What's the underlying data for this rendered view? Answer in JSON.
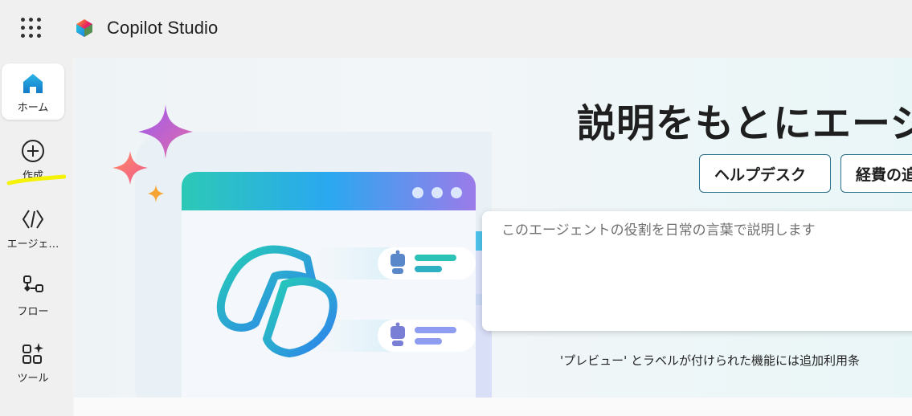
{
  "app": {
    "title": "Copilot Studio"
  },
  "rail": {
    "items": [
      {
        "label": "ホーム",
        "icon": "home-icon",
        "active": true
      },
      {
        "label": "作成",
        "icon": "plus-circle-icon"
      },
      {
        "label": "エージェ…",
        "icon": "code-brackets-icon"
      },
      {
        "label": "フロー",
        "icon": "flow-icon"
      },
      {
        "label": "ツール",
        "icon": "tools-icon"
      }
    ]
  },
  "hero": {
    "title": "説明をもとにエージ",
    "chips": [
      "ヘルプデスク",
      "経費の追"
    ],
    "prompt_placeholder": "このエージェントの役割を日常の言葉で説明します",
    "disclaimer": "'プレビュー' とラベルが付けられた機能には追加利用条"
  },
  "colors": {
    "accent": "#0f6cbd",
    "highlight": "#f5f20a",
    "home_icon": "#1a9bd7"
  }
}
